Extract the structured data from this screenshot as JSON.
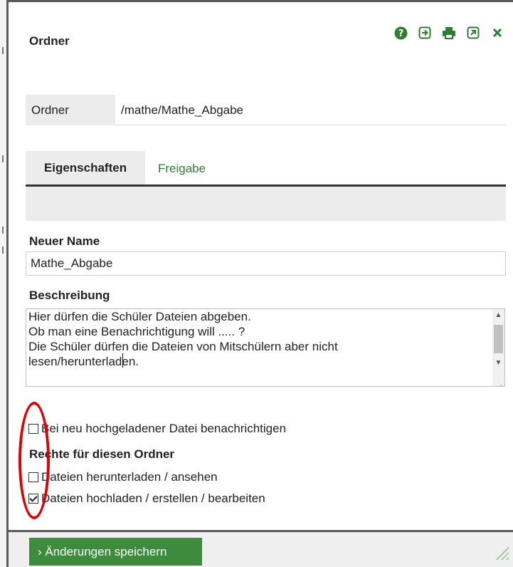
{
  "dialog": {
    "title": "Ordner",
    "icons": [
      "help-icon",
      "open-icon",
      "print-icon",
      "external-icon",
      "close-icon"
    ]
  },
  "path": {
    "label": "Ordner",
    "value": "/mathe/Mathe_Abgabe"
  },
  "tabs": {
    "active": "Eigenschaften",
    "inactive": "Freigabe"
  },
  "form": {
    "name_label": "Neuer Name",
    "name_value": "Mathe_Abgabe",
    "desc_label": "Beschreibung",
    "desc_lines": [
      "Hier dürfen die Schüler Dateien abgeben.",
      "Ob man eine Benachrichtigung will ..... ?",
      "Die Schüler dürfen die Dateien von Mitschülern aber nicht",
      "lesen/herunterladen."
    ],
    "notify_label": "Bei neu hochgeladener Datei benachrichtigen",
    "notify_checked": false,
    "rights_label": "Rechte für diesen Ordner",
    "rights": [
      {
        "label": "Dateien herunterladen / ansehen",
        "checked": false
      },
      {
        "label": "Dateien hochladen / erstellen / bearbeiten",
        "checked": true
      }
    ]
  },
  "footer": {
    "save_label": "› Änderungen speichern"
  },
  "colors": {
    "accent_green": "#3d8b3d",
    "tab_link_green": "#2e7d32",
    "annotation_red": "#e00000"
  }
}
